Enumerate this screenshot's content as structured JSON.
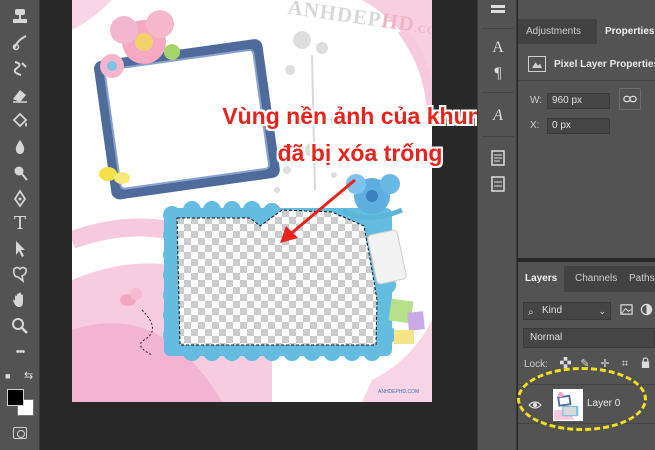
{
  "toolbar": {
    "tools": [
      "stamp-icon",
      "history-brush-icon",
      "eraser-icon",
      "paint-bucket-icon",
      "blur-drop-icon",
      "dodge-icon",
      "pen-icon",
      "type-icon",
      "path-select-icon",
      "custom-shape-icon",
      "hand-icon",
      "zoom-icon",
      "more-tools-icon"
    ],
    "type_glyph": "T",
    "more_glyph": "•••"
  },
  "document": {
    "watermark_main": "ANHDEP",
    "watermark_hd": "HD",
    "watermark_com": ".COM",
    "caption_line1": "Vùng nền ảnh của khung",
    "caption_line2": "đã bị xóa trống",
    "bottom_credit": "ANHDEPHD.COM",
    "colors": {
      "caption": "#e8231c",
      "frame_blue": "#4e6b9c",
      "scallop_blue": "#64bde0",
      "pink_arc": "#f3b9d6"
    }
  },
  "properties_panel": {
    "tabs": [
      "Adjustments",
      "Properties"
    ],
    "active_tab": "Properties",
    "title": "Pixel Layer Properties",
    "w_label": "W:",
    "w_value": "960 px",
    "x_label": "X:",
    "x_value": "0 px",
    "link_icon": "link-icon"
  },
  "layers_panel": {
    "tabs": [
      "Layers",
      "Channels",
      "Paths"
    ],
    "active_tab": "Layers",
    "filter_kind": "Kind",
    "blend_mode": "Normal",
    "lock_label": "Lock:",
    "layer_name": "Layer 0"
  }
}
